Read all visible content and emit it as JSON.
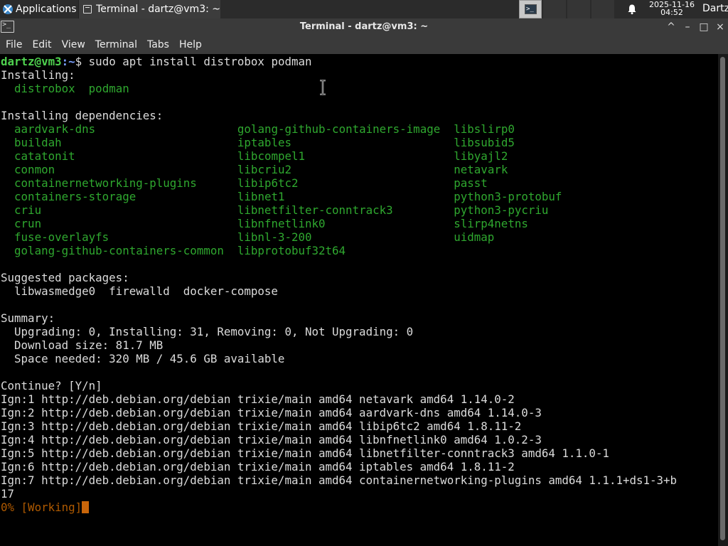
{
  "panel": {
    "apps_label": "Applications",
    "apps_separator": "≡",
    "task_title": "Terminal - dartz@vm3: ~",
    "clock_date": "2025-11-16",
    "clock_time": "04:52",
    "user": "Dartz",
    "icons": {
      "apps": "xfce-logo-icon",
      "task": "terminal-icon",
      "workspace": "terminal-icon",
      "notifications": "bell-icon"
    }
  },
  "window": {
    "title": "Terminal - dartz@vm3: ~",
    "icon": "terminal-icon",
    "controls": [
      "^",
      "–",
      "□",
      "×"
    ]
  },
  "menu": {
    "items": [
      "File",
      "Edit",
      "View",
      "Terminal",
      "Tabs",
      "Help"
    ]
  },
  "terminal": {
    "prompt_user": "dartz@vm3",
    "prompt_path": ":~",
    "prompt_sign": "$",
    "command": " sudo apt install distrobox podman",
    "installing_header": "Installing:",
    "installing_packages": [
      "distrobox",
      "podman"
    ],
    "deps_header": "Installing dependencies:",
    "deps_columns": [
      [
        "aardvark-dns",
        "buildah",
        "catatonit",
        "conmon",
        "containernetworking-plugins",
        "containers-storage",
        "criu",
        "crun",
        "fuse-overlayfs",
        "golang-github-containers-common"
      ],
      [
        "golang-github-containers-image",
        "iptables",
        "libcompel1",
        "libcriu2",
        "libip6tc2",
        "libnet1",
        "libnetfilter-conntrack3",
        "libnfnetlink0",
        "libnl-3-200",
        "libprotobuf32t64"
      ],
      [
        "libslirp0",
        "libsubid5",
        "libyajl2",
        "netavark",
        "passt",
        "python3-protobuf",
        "python3-pycriu",
        "slirp4netns",
        "uidmap"
      ]
    ],
    "suggested_header": "Suggested packages:",
    "suggested_packages": "  libwasmedge0  firewalld  docker-compose",
    "summary_header": "Summary:",
    "summary_lines": [
      "  Upgrading: 0, Installing: 31, Removing: 0, Not Upgrading: 0",
      "  Download size: 81.7 MB",
      "  Space needed: 320 MB / 45.6 GB available"
    ],
    "continue_prompt": "Continue? [Y/n]",
    "ign_lines": [
      "Ign:1 http://deb.debian.org/debian trixie/main amd64 netavark amd64 1.14.0-2",
      "Ign:2 http://deb.debian.org/debian trixie/main amd64 aardvark-dns amd64 1.14.0-3",
      "Ign:3 http://deb.debian.org/debian trixie/main amd64 libip6tc2 amd64 1.8.11-2",
      "Ign:4 http://deb.debian.org/debian trixie/main amd64 libnfnetlink0 amd64 1.0.2-3",
      "Ign:5 http://deb.debian.org/debian trixie/main amd64 libnetfilter-conntrack3 amd64 1.1.0-1",
      "Ign:6 http://deb.debian.org/debian trixie/main amd64 iptables amd64 1.8.11-2",
      "Ign:7 http://deb.debian.org/debian trixie/main amd64 containernetworking-plugins amd64 1.1.1+ds1-3+b",
      "17"
    ],
    "progress_percent": "0%",
    "progress_status": " [Working]"
  },
  "colors": {
    "package_green": "#2fa82f",
    "prompt_green": "#4fd24f",
    "prompt_blue": "#7aa0ff",
    "progress_orange": "#b05a00",
    "cursor_orange": "#c8650a"
  }
}
